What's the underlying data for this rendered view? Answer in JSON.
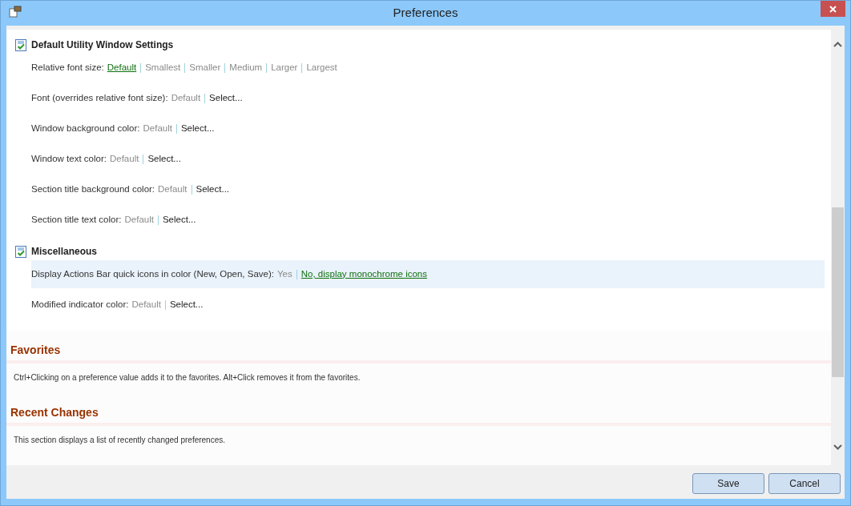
{
  "window": {
    "title": "Preferences"
  },
  "sections": [
    {
      "title": "Default Utility Window Settings",
      "settings": [
        {
          "label": "Relative font size:",
          "highlighted": false,
          "options": [
            {
              "text": "Default",
              "kind": "value",
              "selected": true
            },
            {
              "text": "Smallest",
              "kind": "value",
              "selected": false
            },
            {
              "text": "Smaller",
              "kind": "value",
              "selected": false
            },
            {
              "text": "Medium",
              "kind": "value",
              "selected": false
            },
            {
              "text": "Larger",
              "kind": "value",
              "selected": false
            },
            {
              "text": "Largest",
              "kind": "value",
              "selected": false
            }
          ]
        },
        {
          "label": "Font (overrides relative font size):",
          "highlighted": false,
          "options": [
            {
              "text": "Default",
              "kind": "value",
              "selected": false
            },
            {
              "text": "Select...",
              "kind": "action",
              "selected": false
            }
          ]
        },
        {
          "label": "Window background color:",
          "highlighted": false,
          "options": [
            {
              "text": "Default",
              "kind": "value",
              "selected": false
            },
            {
              "text": "Select...",
              "kind": "action",
              "selected": false
            }
          ]
        },
        {
          "label": "Window text color:",
          "highlighted": false,
          "options": [
            {
              "text": "Default",
              "kind": "value",
              "selected": false
            },
            {
              "text": "Select...",
              "kind": "action",
              "selected": false
            }
          ]
        },
        {
          "label": "Section title background color:",
          "highlighted": false,
          "options": [
            {
              "text": "Default",
              "kind": "value",
              "selected": false
            },
            {
              "text": "Select...",
              "kind": "action",
              "selected": false
            }
          ]
        },
        {
          "label": "Section title text color:",
          "highlighted": false,
          "options": [
            {
              "text": "Default",
              "kind": "value",
              "selected": false
            },
            {
              "text": "Select...",
              "kind": "action",
              "selected": false
            }
          ]
        }
      ]
    },
    {
      "title": "Miscellaneous",
      "settings": [
        {
          "label": "Display Actions Bar quick icons in color (New, Open, Save):",
          "highlighted": true,
          "options": [
            {
              "text": "Yes",
              "kind": "value",
              "selected": false
            },
            {
              "text": "No, display monochrome icons",
              "kind": "value",
              "selected": true
            }
          ]
        },
        {
          "label": "Modified indicator color:",
          "highlighted": false,
          "options": [
            {
              "text": "Default",
              "kind": "value",
              "selected": false
            },
            {
              "text": "Select...",
              "kind": "action",
              "selected": false
            }
          ]
        }
      ]
    }
  ],
  "info_panels": [
    {
      "title": "Favorites",
      "text": "Ctrl+Clicking on a preference value adds it to the favorites. Alt+Click removes it from the favorites."
    },
    {
      "title": "Recent Changes",
      "text": "This section displays a list of recently changed preferences."
    }
  ],
  "buttons": [
    "Save",
    "Cancel"
  ]
}
